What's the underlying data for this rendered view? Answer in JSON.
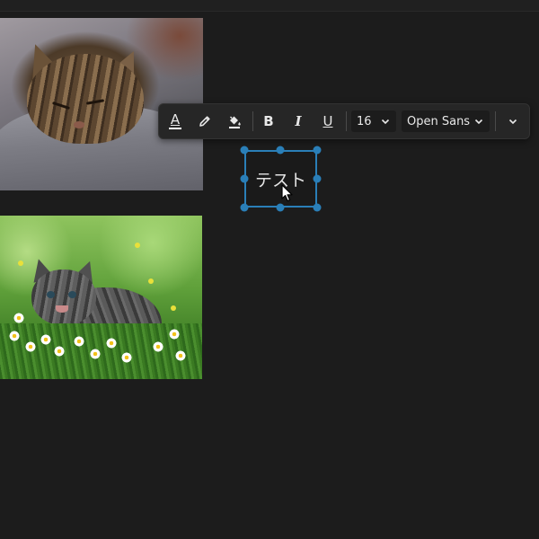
{
  "photos": [
    {
      "name": "sleeping-tabby-cat-photo"
    },
    {
      "name": "kitten-in-daisies-photo"
    }
  ],
  "toolbar": {
    "font_color_icon": "font-color-icon",
    "highlight_icon": "pencil-icon",
    "fill_icon": "paint-bucket-icon",
    "bold_label": "B",
    "italic_label": "I",
    "underline_label": "U",
    "font_size": "16",
    "font_family": "Open Sans",
    "more_icon": "chevron-down-icon"
  },
  "textbox": {
    "text": "テスト"
  },
  "colors": {
    "background": "#1c1c1c",
    "toolbar": "#262626",
    "selection": "#2a7fb8",
    "font_color_bar": "#ffffff",
    "fill_color_bar": "#ffffff"
  }
}
